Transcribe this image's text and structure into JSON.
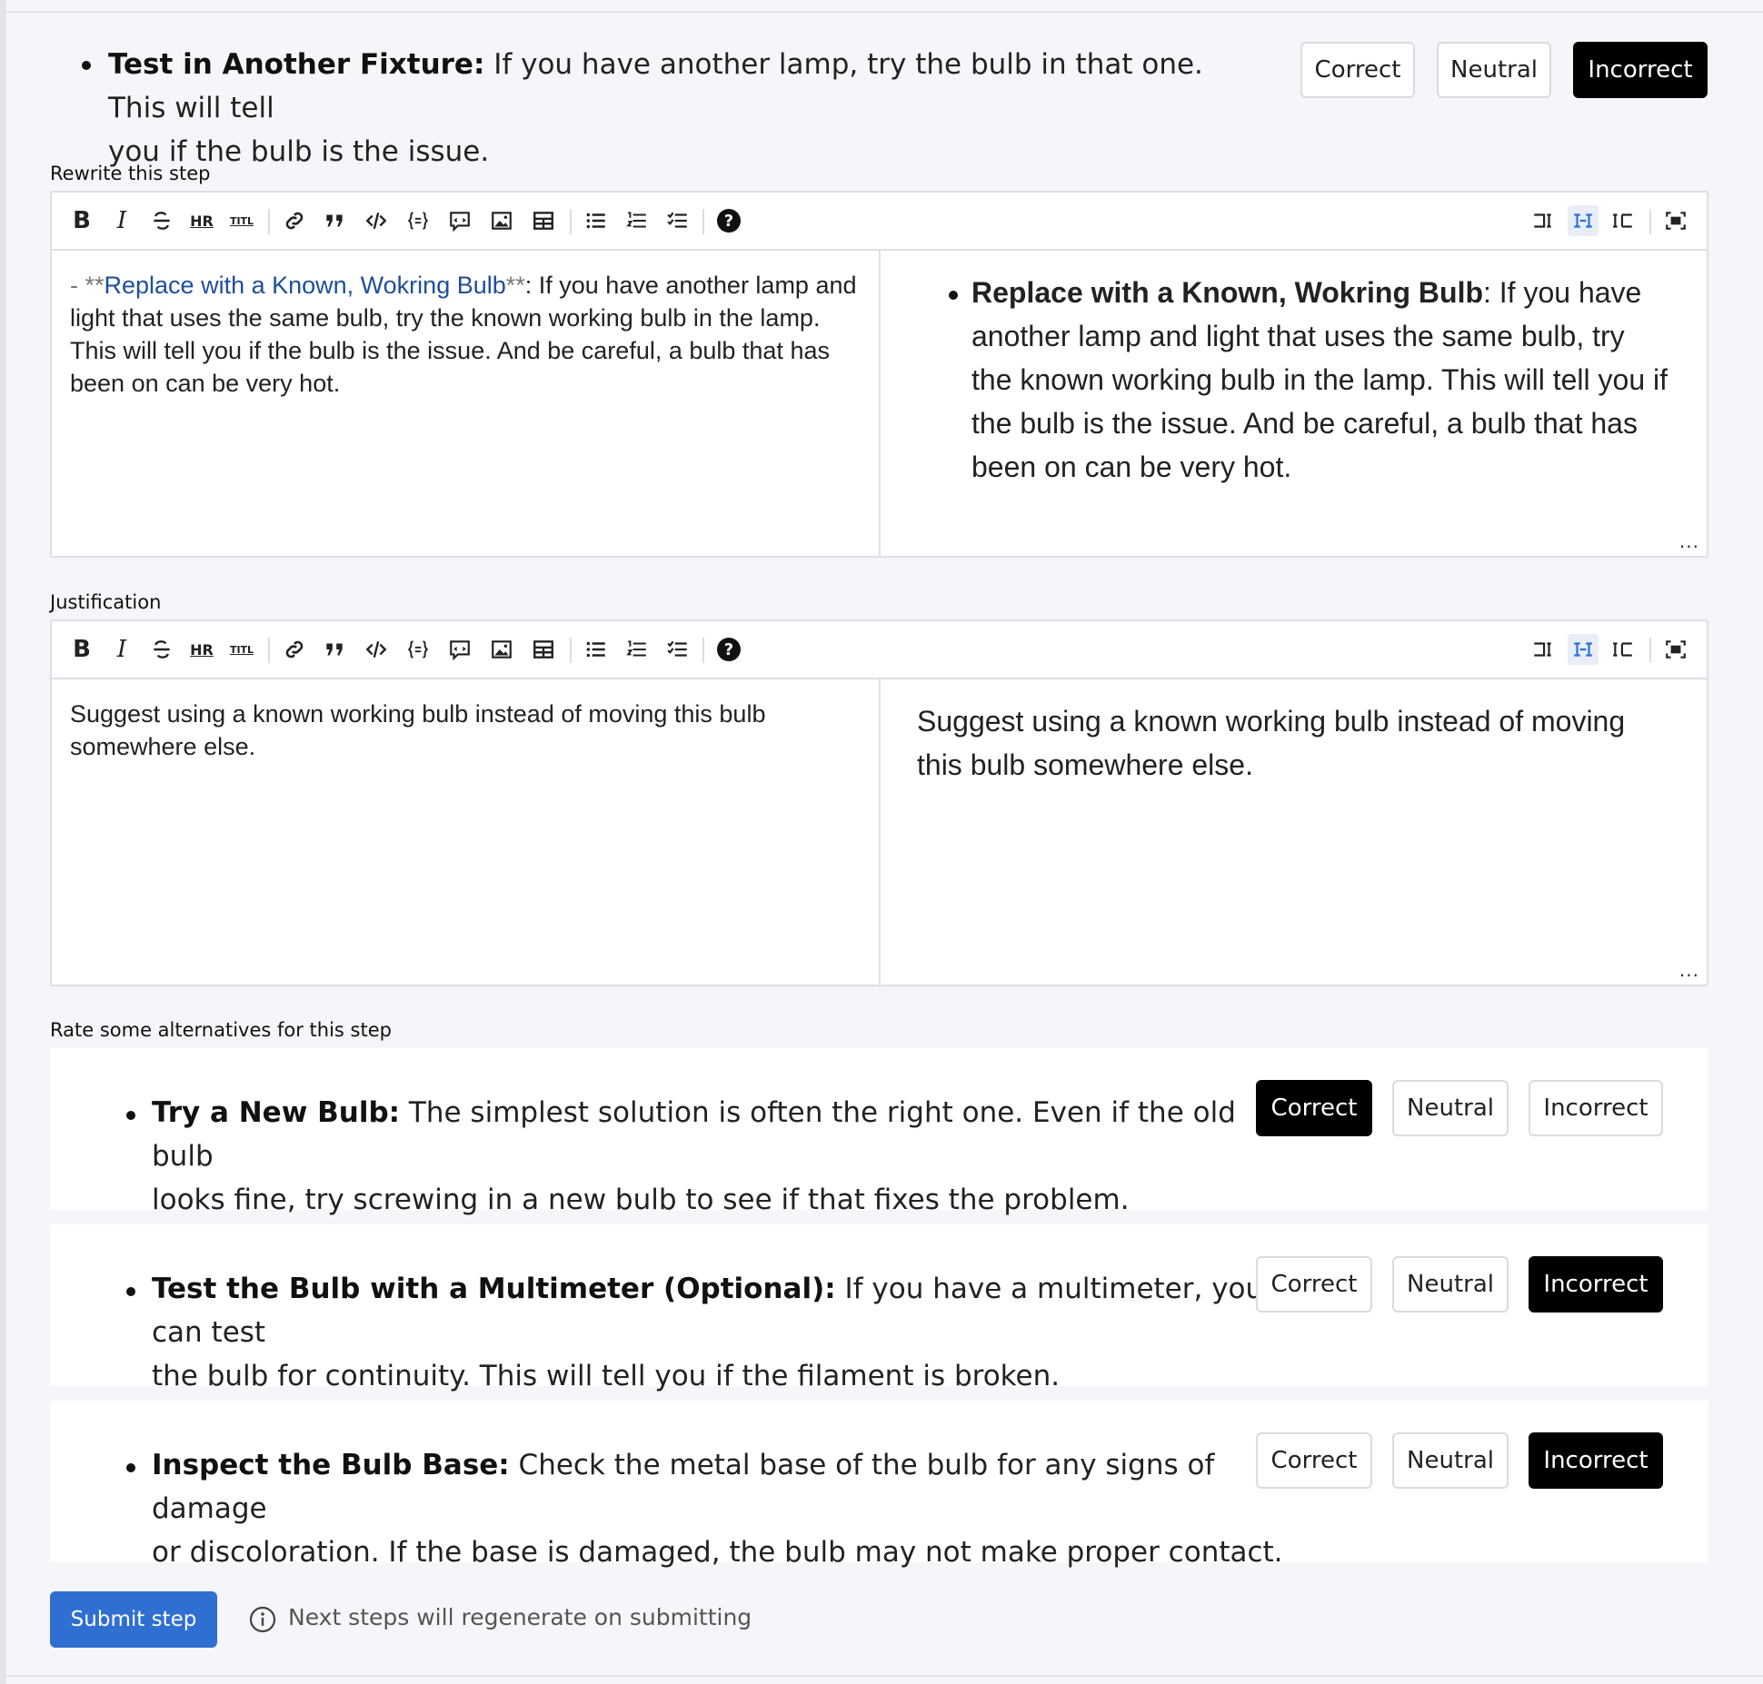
{
  "top_step": {
    "title": "Test in Another Fixture:",
    "body": " If you have another lamp, try the bulb in that one. This will tell",
    "body2": "you if the bulb is the issue.",
    "rating": {
      "correct": "Correct",
      "neutral": "Neutral",
      "incorrect": "Incorrect",
      "selected": "incorrect"
    }
  },
  "rewrite": {
    "label": "Rewrite this step",
    "source_prefix": "- **",
    "source_link": "Replace with a Known, Wokring Bulb",
    "source_suffix": "**",
    "source_body": ": If you have another lamp and light that uses the same bulb, try the known working bulb in the lamp. This will tell you if the bulb is the issue. And be careful, a bulb that has been on can be very hot.",
    "preview_title": "Replace with a Known, Wokring Bulb",
    "preview_body": ": If you have another lamp and light that uses the same bulb, try the known working bulb in the lamp. This will tell you if the bulb is the issue. And be careful, a bulb that has been on can be very hot."
  },
  "justification": {
    "label": "Justification",
    "source": "Suggest using a known working bulb instead of moving this bulb somewhere else.",
    "preview": "Suggest using a known working bulb instead of moving this bulb somewhere else."
  },
  "toolbar": {
    "icons": [
      "bold-icon",
      "italic-icon",
      "strikethrough-icon",
      "horizontal-rule-icon",
      "title-icon",
      "link-icon",
      "quote-icon",
      "code-icon",
      "code-block-icon",
      "comment-icon",
      "image-icon",
      "table-icon",
      "unordered-list-icon",
      "ordered-list-icon",
      "checklist-icon",
      "help-icon",
      "edit-only-icon",
      "split-view-icon",
      "preview-only-icon",
      "fullscreen-icon"
    ],
    "bold": "B",
    "italic": "I",
    "hr": "HR",
    "title": "TITL",
    "help": "?",
    "dots": "..."
  },
  "alternatives": {
    "label": "Rate some alternatives for this step",
    "items": [
      {
        "title": "Try a New Bulb:",
        "body": " The simplest solution is often the right one. Even if the old bulb",
        "body2": "looks fine, try screwing in a new bulb to see if that fixes the problem.",
        "selected": "correct"
      },
      {
        "title": "Test the Bulb with a Multimeter (Optional):",
        "body": " If you have a multimeter, you can test",
        "body2": "the bulb for continuity. This will tell you if the filament is broken.",
        "selected": "incorrect"
      },
      {
        "title": "Inspect the Bulb Base:",
        "body": " Check the metal base of the bulb for any signs of damage",
        "body2": "or discoloration. If the base is damaged, the bulb may not make proper contact.",
        "selected": "incorrect"
      }
    ],
    "correct": "Correct",
    "neutral": "Neutral",
    "incorrect": "Incorrect"
  },
  "footer": {
    "submit_label": "Submit step",
    "info_text": "Next steps will regenerate on submitting"
  },
  "colors": {
    "accent": "#2f6fd1",
    "selected_button": "#000000",
    "link": "#1f4e9b",
    "background": "#f5f6fa"
  }
}
